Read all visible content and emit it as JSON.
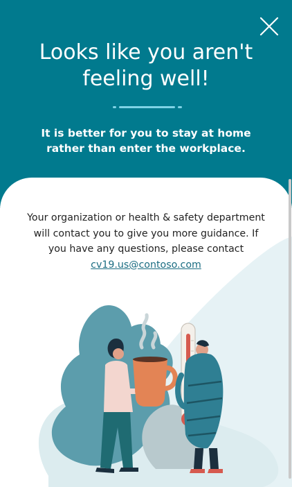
{
  "theme": {
    "header_color": "#017a8e",
    "accent_line_color": "#7fd3e6",
    "link_color": "#1b6d82",
    "illustration_bg": "#e6f2f5"
  },
  "icons": {
    "close": "close-icon",
    "divider": "divider-line"
  },
  "header": {
    "title": "Looks like you aren't feeling well!",
    "subtitle": "It is better for you to stay at home rather than enter the workplace."
  },
  "card": {
    "message_before_link": "Your organization or health & safety department will contact you to give you more guidance. If you have any questions, please contact ",
    "contact_email": "cv19.us@contoso.com"
  }
}
